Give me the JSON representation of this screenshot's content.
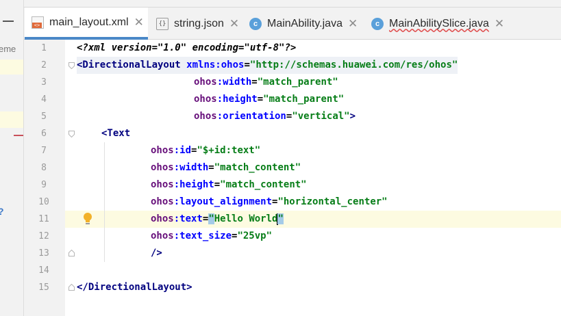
{
  "tabs": [
    {
      "label": "main_layout.xml",
      "icon": "xml-file-icon",
      "active": true
    },
    {
      "label": "string.json",
      "icon": "json-file-icon",
      "active": false
    },
    {
      "label": "MainAbility.java",
      "icon": "java-class-icon",
      "active": false
    },
    {
      "label": "MainAbilitySlice.java",
      "icon": "java-class-icon",
      "active": false,
      "error_underline": true
    }
  ],
  "close_glyph": "✕",
  "left_strip": {
    "partial_text": "eme",
    "partial_glyph": "?"
  },
  "line_numbers": [
    "1",
    "2",
    "3",
    "4",
    "5",
    "6",
    "7",
    "8",
    "9",
    "10",
    "11",
    "12",
    "13",
    "14",
    "15"
  ],
  "code": {
    "l1_a": "<?",
    "l1_b": "xml version=\"1.0\" encoding=\"utf-8\"",
    "l1_c": "?>",
    "l2_tag": "<DirectionalLayout",
    "l2_ns": "xmlns:",
    "l2_ns2": "ohos",
    "l2_eq": "=",
    "l2_val": "\"http://schemas.huawei.com/res/ohos\"",
    "l3_ns": "ohos",
    "l3_attr": ":width",
    "l3_eq": "=",
    "l3_val": "\"match_parent\"",
    "l4_ns": "ohos",
    "l4_attr": ":height",
    "l4_eq": "=",
    "l4_val": "\"match_parent\"",
    "l5_ns": "ohos",
    "l5_attr": ":orientation",
    "l5_eq": "=",
    "l5_val": "\"vertical\"",
    "l5_end": ">",
    "l6_tag": "<Text",
    "l7_ns": "ohos",
    "l7_attr": ":id",
    "l7_eq": "=",
    "l7_val": "\"$+id:text\"",
    "l8_ns": "ohos",
    "l8_attr": ":width",
    "l8_eq": "=",
    "l8_val": "\"match_content\"",
    "l9_ns": "ohos",
    "l9_attr": ":height",
    "l9_eq": "=",
    "l9_val": "\"match_content\"",
    "l10_ns": "ohos",
    "l10_attr": ":layout_alignment",
    "l10_eq": "=",
    "l10_val": "\"horizontal_center\"",
    "l11_ns": "ohos",
    "l11_attr": ":text",
    "l11_eq": "=",
    "l11_q1": "\"",
    "l11_val": "Hello World",
    "l11_q2": "\"",
    "l12_ns": "ohos",
    "l12_attr": ":text_size",
    "l12_eq": "=",
    "l12_val": "\"25vp\"",
    "l13": "/>",
    "l15_tag": "</DirectionalLayout",
    "l15_end": ">"
  },
  "colors": {
    "tag": "#00007f",
    "attr_ns": "#660e7a",
    "attr": "#0000ff",
    "value": "#067d17",
    "active_tab_underline": "#4a88c7",
    "current_line": "#fdfbe1"
  }
}
